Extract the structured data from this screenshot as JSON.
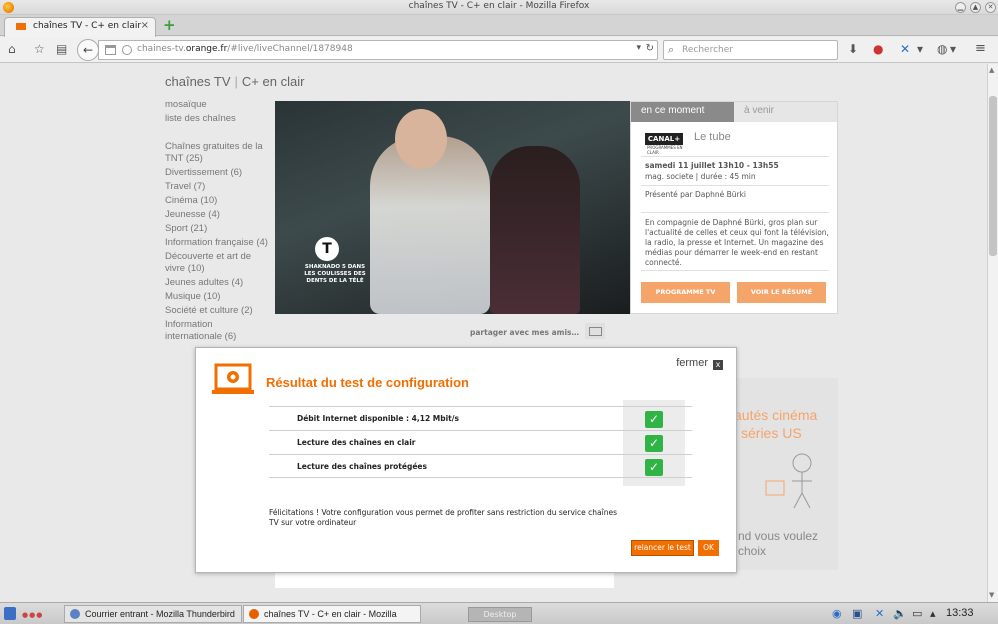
{
  "window": {
    "title": "chaînes TV - C+ en clair - Mozilla Firefox",
    "btn_minimize": "▁",
    "btn_maximize": "▲",
    "btn_close": "✕"
  },
  "browser": {
    "tab_label": "chaînes TV - C+ en clair",
    "tab_close": "×",
    "newtab": "+",
    "url_host": "chaines-tv.",
    "url_domain": "orange.fr",
    "url_path": "/#live/liveChannel/1878948",
    "search_placeholder": "Rechercher"
  },
  "page": {
    "heading_site": "chaînes TV",
    "heading_sep": "|",
    "heading_channel": "C+ en clair",
    "nav_links": [
      "mosaïque",
      "liste des chaînes"
    ],
    "categories": [
      "Chaînes gratuites de la TNT (25)",
      "Divertissement (6)",
      "Travel (7)",
      "Cinéma (10)",
      "Jeunesse (4)",
      "Sport (21)",
      "Information française (4)",
      "Découverte et art de vivre (10)",
      "Jeunes adultes (4)",
      "Musique (10)",
      "Société et culture (2)",
      "Information internationale (6)"
    ],
    "video_caption": "SHAKNADO 5 DANS LES COULISSES DES DENTS DE LA TÉLÉ",
    "video_logo": "T",
    "schedule": {
      "tab_now": "en ce moment",
      "tab_next": "à venir",
      "channel_logo": "CANAL+",
      "channel_sub": "PROGRAMMES EN CLAIR",
      "program_title": "Le tube",
      "date": "samedi 11 juillet 13h10 - 13h55",
      "meta": "mag. societe | durée : 45 min",
      "host": "Présenté par Daphné Bürki",
      "description": "En compagnie de Daphné Bürki, gros plan sur l'actualité de celles et ceux qui font la télévision, la radio, la presse et Internet. Un magazine des médias pour démarrer le week-end en restant connecté.",
      "btn_program": "PROGRAMME TV",
      "btn_summary": "VOIR LE RÉSUMÉ"
    },
    "share_text": "partager avec mes amis…",
    "promo": {
      "line1": "autés cinéma",
      "line2": "séries US",
      "line3": "nd vous voulez",
      "line4": "choix"
    }
  },
  "modal": {
    "close_label": "fermer",
    "close_icon": "x",
    "title": "Résultat du test de configuration",
    "results": [
      {
        "label": "Débit Internet disponible : 4,12 Mbit/s",
        "status": "ok"
      },
      {
        "label": "Lecture des chaînes en clair",
        "status": "ok"
      },
      {
        "label": "Lecture des chaînes protégées",
        "status": "ok"
      }
    ],
    "check_glyph": "✓",
    "message": "Félicitations ! Votre configuration vous permet de profiter sans restriction du service chaînes TV sur votre ordinateur",
    "btn_retest": "relancer le test",
    "btn_ok": "OK"
  },
  "taskbar": {
    "tasks": [
      "Courrier entrant - Mozilla Thunderbird",
      "chaînes TV - C+ en clair - Mozilla Firefox"
    ],
    "desktop_label": "Desktop",
    "clock": "13:33"
  },
  "colors": {
    "orange_accent": "#f16e00",
    "orange_light": "#f5a46a",
    "check_green": "#2fb445",
    "tab_now_bg": "#8a8a8a"
  },
  "icons": {
    "nav": [
      "home-icon",
      "bookmark-star-icon",
      "reading-list-icon"
    ],
    "toolbar_right": [
      "download-icon",
      "addon-icon",
      "addon-2-icon",
      "globe-icon",
      "menu-icon"
    ]
  }
}
